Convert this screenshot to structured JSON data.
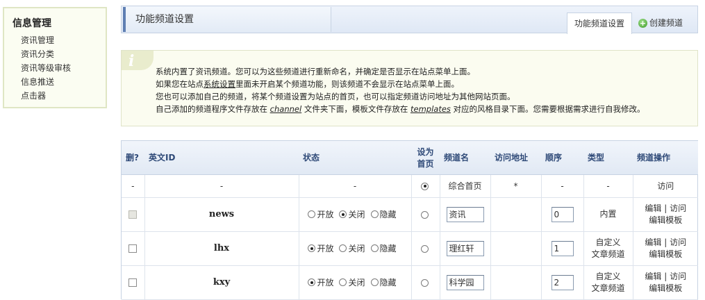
{
  "sidebar": {
    "title": "信息管理",
    "items": [
      "资讯管理",
      "资讯分类",
      "资讯等级审核",
      "信息推送",
      "点击器"
    ]
  },
  "header": {
    "title": "功能频道设置",
    "tab_active": "功能频道设置",
    "tab_create": "创建频道",
    "create_icon": "plus-circle-icon"
  },
  "info": {
    "icon": "info-icon",
    "line1": "系统内置了资讯频道。您可以为这些频道进行重新命名，并确定是否显示在站点菜单上面。",
    "line2_a": "如果您在站点",
    "line2_link": "系统设置",
    "line2_b": "里面未开启某个频道功能，则该频道不会显示在站点菜单上面。",
    "line3": "您也可以添加自己的频道，将某个频道设置为站点的首页，也可以指定频道访问地址为其他网站页面。",
    "line4_a": "自己添加的频道程序文件存放在 ",
    "line4_channel": "channel",
    "line4_b": " 文件夹下面，模板文件存放在 ",
    "line4_templates": "templates",
    "line4_c": " 对应的风格目录下面。您需要根据需求进行自我修改。"
  },
  "table": {
    "headers": {
      "del": "删?",
      "id": "英文ID",
      "status": "状态",
      "home_line1": "设为",
      "home_line2": "首页",
      "name": "频道名",
      "url": "访问地址",
      "order": "顺序",
      "type": "类型",
      "ops": "频道操作"
    },
    "status_labels": {
      "open": "开放",
      "close": "关闭",
      "hide": "隐藏"
    },
    "default_row": {
      "del": "-",
      "id": "-",
      "status": "-",
      "home_selected": true,
      "name": "综合首页",
      "url": "*",
      "order": "-",
      "type": "-",
      "op": "访问"
    },
    "rows": [
      {
        "id": "news",
        "status": "close",
        "name": "资讯",
        "order": "0",
        "type_line1": "内置",
        "type_line2": "",
        "op_edit": "编辑",
        "op_visit": "访问",
        "op_tpl": "编辑模板",
        "del_disabled": true
      },
      {
        "id": "lhx",
        "status": "open",
        "name": "理红轩",
        "order": "1",
        "type_line1": "自定义",
        "type_line2": "文章频道",
        "op_edit": "编辑",
        "op_visit": "访问",
        "op_tpl": "编辑模板",
        "del_disabled": false
      },
      {
        "id": "kxy",
        "status": "open",
        "name": "科学园",
        "order": "2",
        "type_line1": "自定义",
        "type_line2": "文章频道",
        "op_edit": "编辑",
        "op_visit": "访问",
        "op_tpl": "编辑模板",
        "del_disabled": false
      }
    ]
  }
}
